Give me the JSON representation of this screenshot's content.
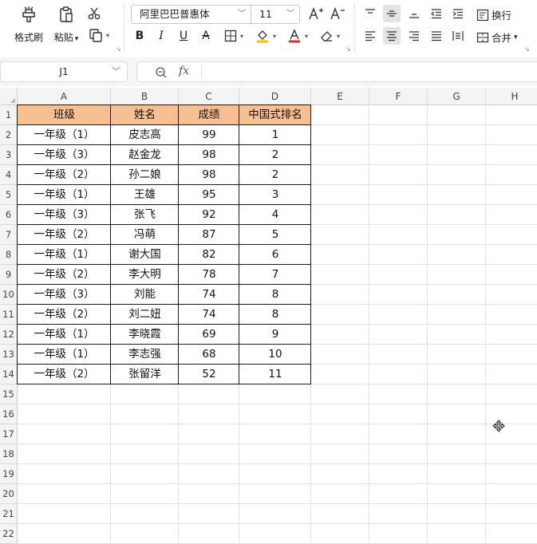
{
  "ribbon": {
    "format_painter_label": "格式刷",
    "paste_label": "粘贴",
    "font_name": "阿里巴巴普惠体",
    "font_size": "11",
    "wrap_label": "换行",
    "merge_label": "合并"
  },
  "formula_bar": {
    "name_box": "J1",
    "fx_label": "fx",
    "formula": ""
  },
  "sheet": {
    "columns": [
      "A",
      "B",
      "C",
      "D",
      "E",
      "F",
      "G",
      "H"
    ],
    "rows": [
      "1",
      "2",
      "3",
      "4",
      "5",
      "6",
      "7",
      "8",
      "9",
      "10",
      "11",
      "12",
      "13",
      "14",
      "15",
      "16",
      "17",
      "18",
      "19",
      "20",
      "21",
      "22"
    ],
    "table_header": [
      "班级",
      "姓名",
      "成绩",
      "中国式排名"
    ],
    "table_rows": [
      [
        "一年级（1）",
        "皮志高",
        "99",
        "1"
      ],
      [
        "一年级（3）",
        "赵金龙",
        "98",
        "2"
      ],
      [
        "一年级（2）",
        "孙二娘",
        "98",
        "2"
      ],
      [
        "一年级（1）",
        "王雄",
        "95",
        "3"
      ],
      [
        "一年级（3）",
        "张飞",
        "92",
        "4"
      ],
      [
        "一年级（2）",
        "冯萌",
        "87",
        "5"
      ],
      [
        "一年级（1）",
        "谢大国",
        "82",
        "6"
      ],
      [
        "一年级（2）",
        "李大明",
        "78",
        "7"
      ],
      [
        "一年级（3）",
        "刘能",
        "74",
        "8"
      ],
      [
        "一年级（2）",
        "刘二妞",
        "74",
        "8"
      ],
      [
        "一年级（1）",
        "李晓霞",
        "69",
        "9"
      ],
      [
        "一年级（1）",
        "李志强",
        "68",
        "10"
      ],
      [
        "一年级（2）",
        "张留洋",
        "52",
        "11"
      ]
    ]
  },
  "colors": {
    "header_fill": "#f8c090",
    "table_border": "#1a1a1a",
    "font_color_underline": "#d0312d",
    "fill_color_underline": "#f5c400"
  }
}
